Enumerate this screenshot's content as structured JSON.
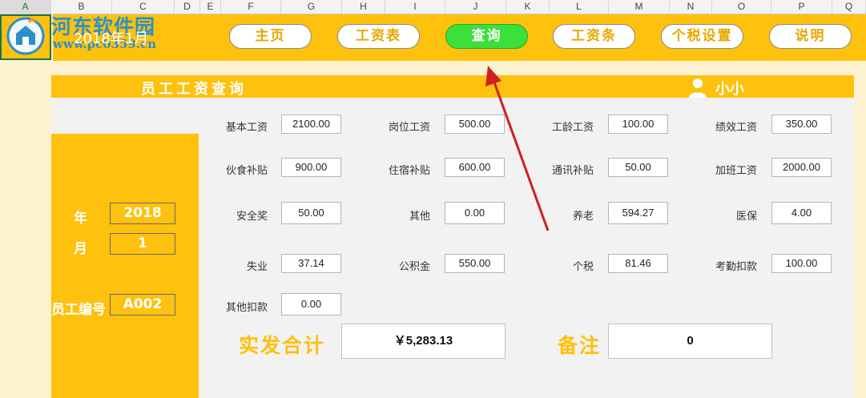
{
  "columns": [
    "A",
    "B",
    "C",
    "D",
    "E",
    "F",
    "G",
    "H",
    "I",
    "J",
    "K",
    "L",
    "M",
    "N",
    "O",
    "P",
    "Q"
  ],
  "brand": {
    "name": "河东软件园",
    "url": "www.pc0359.cn"
  },
  "header": {
    "date": "2018年1月"
  },
  "nav": [
    {
      "label": "主页"
    },
    {
      "label": "工资表"
    },
    {
      "label": "查询",
      "active": true
    },
    {
      "label": "工资条"
    },
    {
      "label": "个税设置"
    },
    {
      "label": "说明"
    }
  ],
  "panel": {
    "title": "员工工资查询",
    "user": "小小"
  },
  "left": {
    "year_label": "年",
    "year": "2018",
    "month_label": "月",
    "month": "1",
    "id_label": "员工编号",
    "id": "A002"
  },
  "fields": [
    {
      "label": "基本工资",
      "value": "2100.00"
    },
    {
      "label": "岗位工资",
      "value": "500.00"
    },
    {
      "label": "工龄工资",
      "value": "100.00"
    },
    {
      "label": "绩效工资",
      "value": "350.00"
    },
    {
      "label": "伙食补贴",
      "value": "900.00"
    },
    {
      "label": "住宿补贴",
      "value": "600.00"
    },
    {
      "label": "通讯补贴",
      "value": "50.00"
    },
    {
      "label": "加班工资",
      "value": "2000.00"
    },
    {
      "label": "安全奖",
      "value": "50.00"
    },
    {
      "label": "其他",
      "value": "0.00"
    },
    {
      "label": "养老",
      "value": "594.27"
    },
    {
      "label": "医保",
      "value": "4.00"
    },
    {
      "label": "失业",
      "value": "37.14"
    },
    {
      "label": "公积金",
      "value": "550.00"
    },
    {
      "label": "个税",
      "value": "81.46"
    },
    {
      "label": "考勤扣款",
      "value": "100.00"
    },
    {
      "label": "其他扣款",
      "value": "0.00"
    }
  ],
  "total": {
    "label": "实发合计",
    "value": "￥5,283.13"
  },
  "remark": {
    "label": "备注",
    "value": "0"
  },
  "colors": {
    "accent": "#fec10d",
    "active": "#3be03b",
    "arrow": "#d01f1f"
  }
}
